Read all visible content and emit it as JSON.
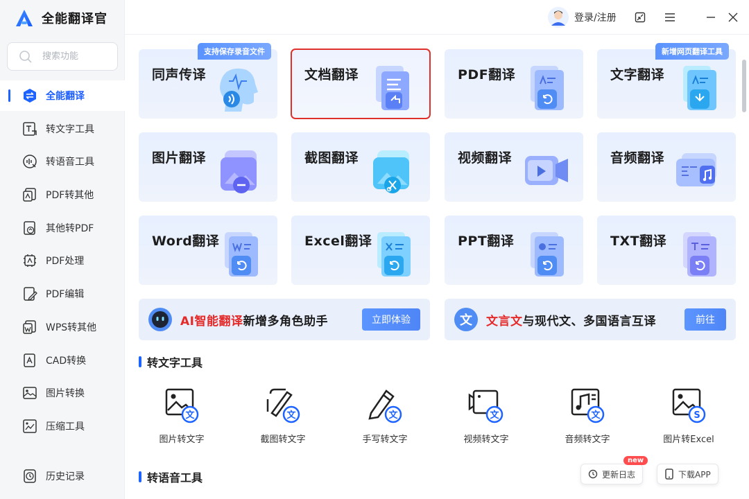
{
  "app": {
    "title": "全能翻译官"
  },
  "search": {
    "placeholder": "搜索功能"
  },
  "header": {
    "login": "登录/注册"
  },
  "sidebar": {
    "items": [
      {
        "label": "全能翻译",
        "icon": "translate-icon",
        "active": true
      },
      {
        "label": "转文字工具",
        "icon": "text-tool-icon"
      },
      {
        "label": "转语音工具",
        "icon": "voice-tool-icon"
      },
      {
        "label": "PDF转其他",
        "icon": "pdf-convert-icon"
      },
      {
        "label": "其他转PDF",
        "icon": "to-pdf-icon"
      },
      {
        "label": "PDF处理",
        "icon": "pdf-process-icon"
      },
      {
        "label": "PDF编辑",
        "icon": "pdf-edit-icon"
      },
      {
        "label": "WPS转其他",
        "icon": "wps-convert-icon"
      },
      {
        "label": "CAD转换",
        "icon": "cad-convert-icon"
      },
      {
        "label": "图片转换",
        "icon": "image-convert-icon"
      },
      {
        "label": "压缩工具",
        "icon": "compress-icon"
      },
      {
        "label": "历史记录",
        "icon": "history-icon"
      }
    ]
  },
  "cards": [
    {
      "title": "同声传译",
      "icon": "voice-head-icon",
      "tag": "支持保存录音文件"
    },
    {
      "title": "文档翻译",
      "icon": "document-icon",
      "selected": true
    },
    {
      "title": "PDF翻译",
      "icon": "pdf-doc-icon"
    },
    {
      "title": "文字翻译",
      "icon": "text-doc-icon",
      "tag": "新增网页翻译工具"
    },
    {
      "title": "图片翻译",
      "icon": "image-icon"
    },
    {
      "title": "截图翻译",
      "icon": "screenshot-icon"
    },
    {
      "title": "视频翻译",
      "icon": "video-icon"
    },
    {
      "title": "音频翻译",
      "icon": "audio-icon"
    },
    {
      "title": "Word翻译",
      "icon": "word-icon"
    },
    {
      "title": "Excel翻译",
      "icon": "excel-icon"
    },
    {
      "title": "PPT翻译",
      "icon": "ppt-icon"
    },
    {
      "title": "TXT翻译",
      "icon": "txt-icon"
    }
  ],
  "banners": [
    {
      "highlight": "AI智能翻译",
      "text": "新增多角色助手",
      "button": "立即体验",
      "icon": "robot-icon"
    },
    {
      "highlight": "文言文",
      "text": "与现代文、多国语言互译",
      "button": "前往",
      "icon": "wen-icon",
      "icon_text": "文"
    }
  ],
  "sections": [
    {
      "title": "转文字工具"
    },
    {
      "title": "转语音工具"
    }
  ],
  "tools": [
    {
      "label": "图片转文字",
      "icon": "image-to-text-icon"
    },
    {
      "label": "截图转文字",
      "icon": "screenshot-to-text-icon"
    },
    {
      "label": "手写转文字",
      "icon": "handwriting-to-text-icon"
    },
    {
      "label": "视频转文字",
      "icon": "video-to-text-icon"
    },
    {
      "label": "音频转文字",
      "icon": "audio-to-text-icon"
    },
    {
      "label": "图片转Excel",
      "icon": "image-to-excel-icon"
    }
  ],
  "float_buttons": {
    "changelog": "更新日志",
    "changelog_badge": "new",
    "download": "下载APP"
  },
  "colors": {
    "accent": "#1d63ff",
    "highlight": "#e52a2a",
    "selected_border": "#e0302c"
  }
}
